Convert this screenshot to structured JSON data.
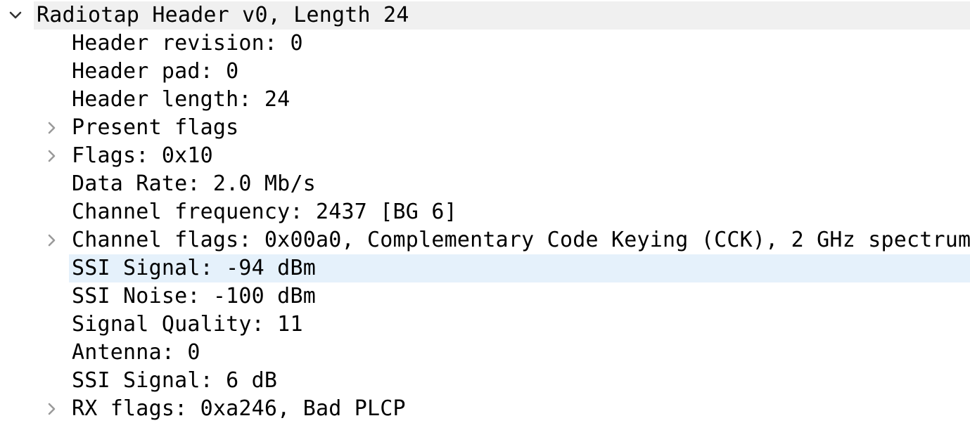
{
  "tree": {
    "root": {
      "label": "Radiotap Header v0, Length 24",
      "expanded": true,
      "icon": "chevron-down-icon"
    },
    "children": [
      {
        "label": "Header revision: 0",
        "expandable": false
      },
      {
        "label": "Header pad: 0",
        "expandable": false
      },
      {
        "label": "Header length: 24",
        "expandable": false
      },
      {
        "label": "Present flags",
        "expandable": true,
        "icon": "chevron-right-icon"
      },
      {
        "label": "Flags: 0x10",
        "expandable": true,
        "icon": "chevron-right-icon"
      },
      {
        "label": "Data Rate: 2.0 Mb/s",
        "expandable": false
      },
      {
        "label": "Channel frequency: 2437 [BG 6]",
        "expandable": false
      },
      {
        "label": "Channel flags: 0x00a0, Complementary Code Keying (CCK), 2 GHz spectrum",
        "expandable": true,
        "icon": "chevron-right-icon"
      },
      {
        "label": "SSI Signal: -94 dBm",
        "expandable": false,
        "selected": true
      },
      {
        "label": "SSI Noise: -100 dBm",
        "expandable": false
      },
      {
        "label": "Signal Quality: 11",
        "expandable": false
      },
      {
        "label": "Antenna: 0",
        "expandable": false
      },
      {
        "label": "SSI Signal: 6 dB",
        "expandable": false
      },
      {
        "label": "RX flags: 0xa246, Bad PLCP",
        "expandable": true,
        "icon": "chevron-right-icon"
      }
    ]
  },
  "colors": {
    "root_background": "#f0f0f0",
    "selected_background": "#e5f1fb",
    "arrow": "#333333",
    "collapsed_arrow": "#9a9a9a"
  }
}
